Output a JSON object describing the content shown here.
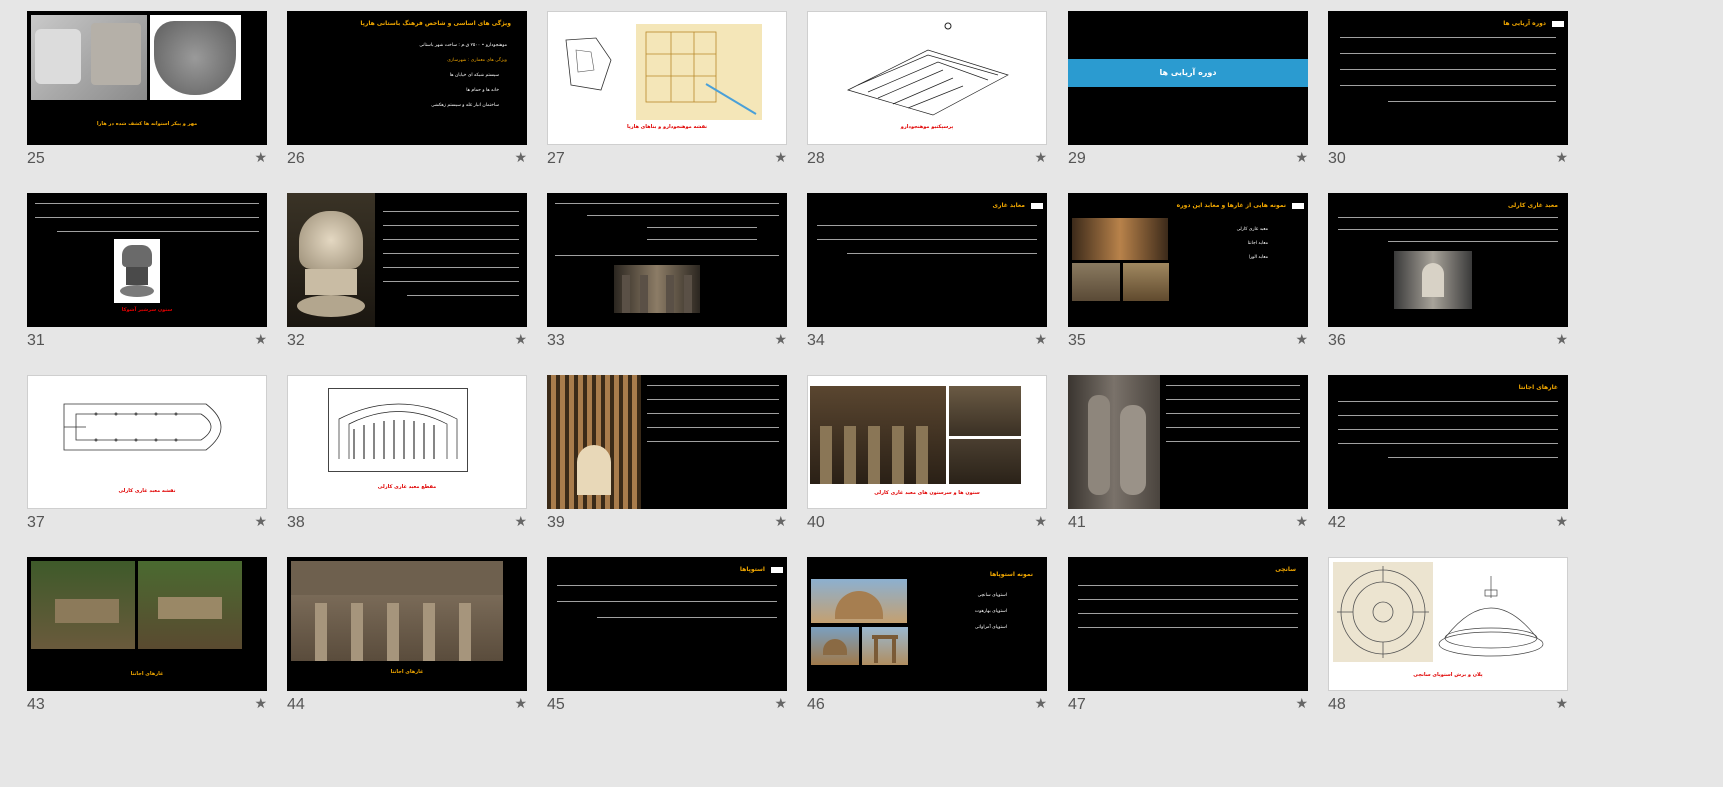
{
  "slides": [
    {
      "num": "25",
      "caption": "مهر و پیکر استوانه ها کشف شده در هارا"
    },
    {
      "num": "26",
      "title": "ویژگی های اساسی و شاخص فرهنگ باستانی هارپا",
      "bullets": [
        "موهنجودارو • ۲۵۰۰ ق.م : ساخت شهر باستانی",
        "ویژگی های معماری : شهرسازی",
        "سیستم شبکه ای خیابان ها",
        "خانه ها و حمام ها",
        "ساختمان انبار غله و سیستم زهکشی"
      ]
    },
    {
      "num": "27",
      "caption": "نقشه موهنجودارو و بناهای هارپا"
    },
    {
      "num": "28",
      "caption": "پرسپکتیو موهنجودارو"
    },
    {
      "num": "29",
      "band": "دوره آریایی ها"
    },
    {
      "num": "30",
      "title": "دوره آریایی ها"
    },
    {
      "num": "31",
      "caption": "ستون سرشیر آشوکا"
    },
    {
      "num": "32"
    },
    {
      "num": "33"
    },
    {
      "num": "34",
      "title": "معابد غاری"
    },
    {
      "num": "35",
      "title": "نمونه هایی از غارها و معابد این دوره",
      "bullets": [
        "معبد غاری کارلی",
        "معابد اجانتا",
        "معابد الورا"
      ]
    },
    {
      "num": "36",
      "title": "معبد غاری کارلی"
    },
    {
      "num": "37",
      "caption": "نقشه معبد غاری کارلی"
    },
    {
      "num": "38",
      "caption": "مقطع معبد غاری کارلی"
    },
    {
      "num": "39"
    },
    {
      "num": "40",
      "caption": "ستون ها و سرستون های معبد غاری کارلی"
    },
    {
      "num": "41"
    },
    {
      "num": "42",
      "title": "غارهای اجانتا"
    },
    {
      "num": "43",
      "caption": "غارهای اجانتا"
    },
    {
      "num": "44",
      "caption": "غارهای اجانتا"
    },
    {
      "num": "45",
      "title": "استوپاها"
    },
    {
      "num": "46",
      "title": "نمونه استوپاها",
      "bullets": [
        "استوپای سانچی",
        "استوپای بهارهوت",
        "استوپای آمراواتی"
      ]
    },
    {
      "num": "47",
      "title": "سانچی"
    },
    {
      "num": "48",
      "caption": "پلان و برش استوپای سانچی"
    }
  ],
  "star_glyph": "★"
}
